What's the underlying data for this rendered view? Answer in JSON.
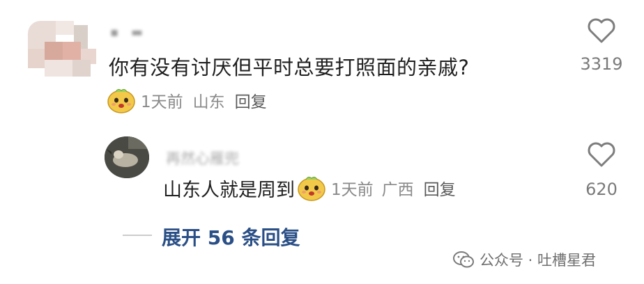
{
  "comment": {
    "username": "▪ ▬",
    "text": "你有没有讨厌但平时总要打照面的亲戚?",
    "time": "1天前",
    "location": "山东",
    "reply_label": "回复",
    "likes": "3319",
    "avatar_icon": "pixelated-avatar",
    "badge_icon": "yellow-mascot-icon"
  },
  "reply": {
    "username": "再然心雁兜",
    "text": "山东人就是周到",
    "time": "1天前",
    "location": "广西",
    "reply_label": "回复",
    "likes": "620",
    "avatar_icon": "bird-photo-avatar",
    "badge_icon": "yellow-mascot-icon"
  },
  "expand_replies": "展开 56 条回复",
  "watermark": "公众号 · 吐槽星君",
  "colors": {
    "link": "#2a4f86",
    "meta": "#8a8a8a",
    "text": "#1f1f1f",
    "mascot": "#f3c94a"
  }
}
